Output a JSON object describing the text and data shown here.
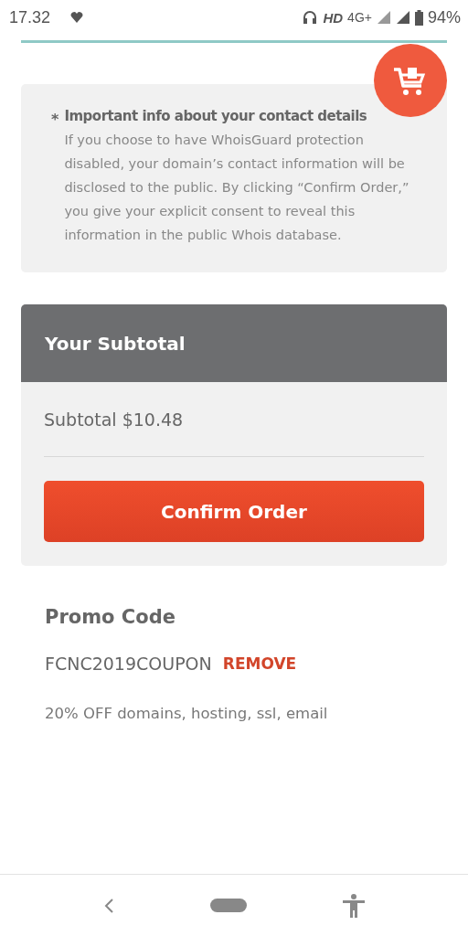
{
  "status_bar": {
    "time": "17.32",
    "hd": "HD",
    "network": "4G+",
    "battery": "94%"
  },
  "info": {
    "marker": "*",
    "title": "Important info about your contact details",
    "body": "If you choose to have WhoisGuard protection disabled, your domain’s contact information will be disclosed to the public. By clicking “Confirm Order,” you give your explicit consent to reveal this information in the public Whois database."
  },
  "subtotal": {
    "title": "Your Subtotal",
    "line": "Subtotal $10.48",
    "button": "Confirm Order"
  },
  "promo": {
    "title": "Promo Code",
    "code": "FCNC2019COUPON",
    "remove": "REMOVE",
    "description": "20% OFF domains, hosting, ssl, email"
  }
}
